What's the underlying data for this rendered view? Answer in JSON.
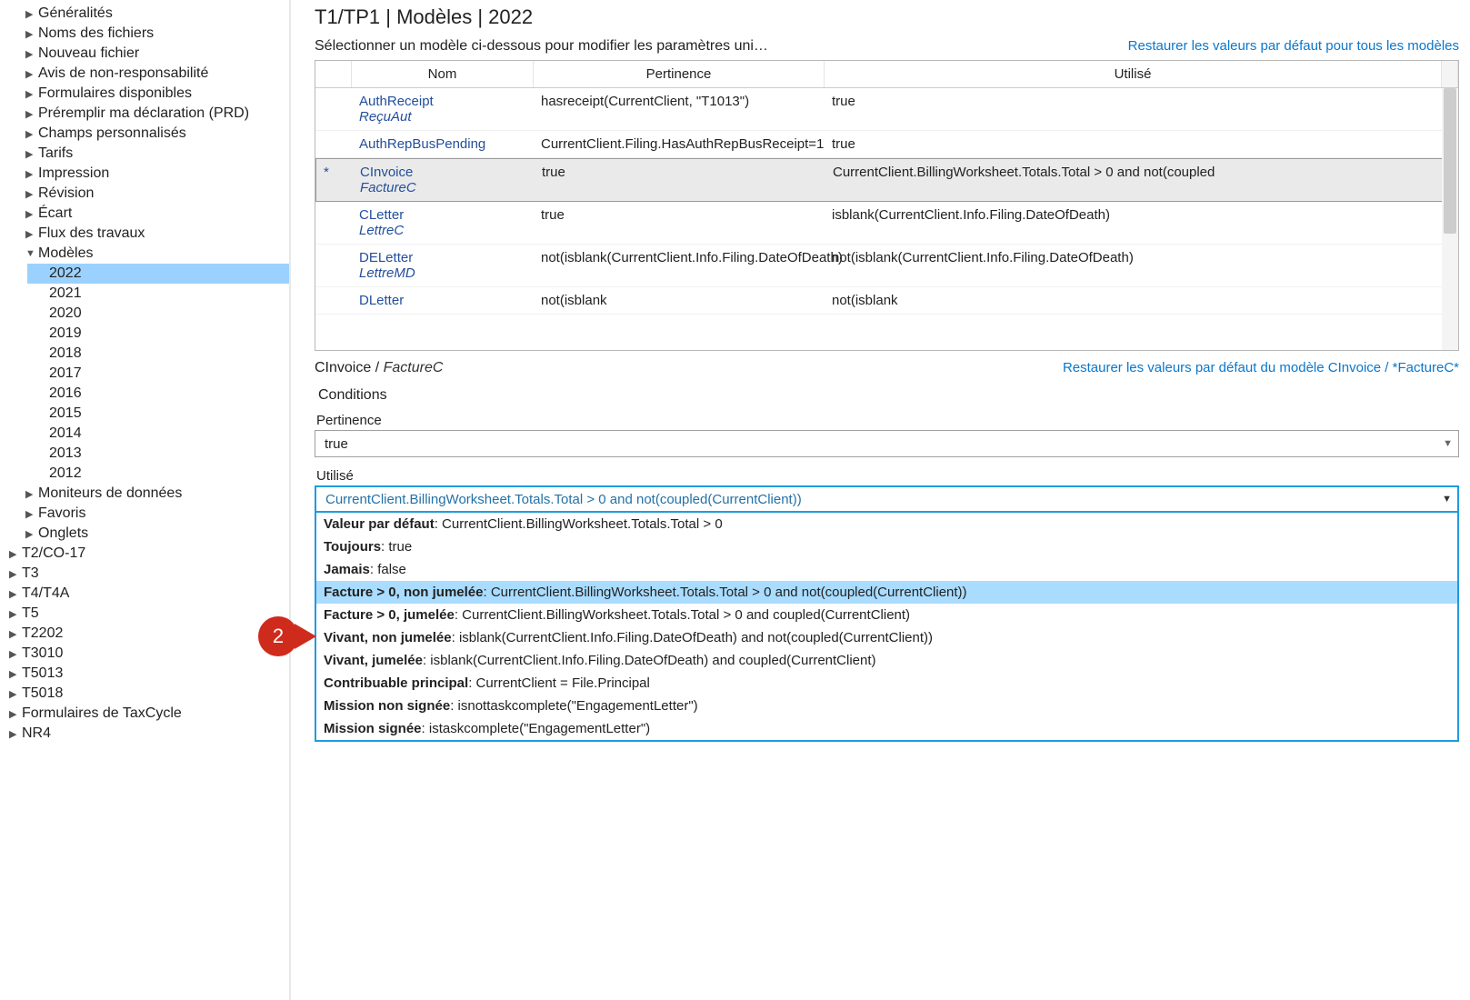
{
  "sidebar": {
    "top": [
      {
        "label": "Généralités",
        "caret": "right"
      },
      {
        "label": "Noms des fichiers",
        "caret": "right"
      },
      {
        "label": "Nouveau fichier",
        "caret": "right"
      },
      {
        "label": "Avis de non-responsabilité",
        "caret": "right"
      },
      {
        "label": "Formulaires disponibles",
        "caret": "right"
      },
      {
        "label": "Préremplir ma déclaration (PRD)",
        "caret": "right"
      },
      {
        "label": "Champs personnalisés",
        "caret": "right"
      },
      {
        "label": "Tarifs",
        "caret": "right"
      },
      {
        "label": "Impression",
        "caret": "right"
      },
      {
        "label": "Révision",
        "caret": "right"
      },
      {
        "label": "Écart",
        "caret": "right"
      },
      {
        "label": "Flux des travaux",
        "caret": "right"
      }
    ],
    "modeles_label": "Modèles",
    "years": [
      "2022",
      "2021",
      "2020",
      "2019",
      "2018",
      "2017",
      "2016",
      "2015",
      "2014",
      "2013",
      "2012"
    ],
    "bottom": [
      {
        "label": "Moniteurs de données",
        "caret": "right"
      },
      {
        "label": "Favoris",
        "caret": "right"
      },
      {
        "label": "Onglets",
        "caret": "right"
      }
    ],
    "root_bottom": [
      {
        "label": "T2/CO-17",
        "caret": "right"
      },
      {
        "label": "T3",
        "caret": "right"
      },
      {
        "label": "T4/T4A",
        "caret": "right"
      },
      {
        "label": "T5",
        "caret": "right"
      },
      {
        "label": "T2202",
        "caret": "right"
      },
      {
        "label": "T3010",
        "caret": "right"
      },
      {
        "label": "T5013",
        "caret": "right"
      },
      {
        "label": "T5018",
        "caret": "right"
      },
      {
        "label": "Formulaires de TaxCycle",
        "caret": "right"
      },
      {
        "label": "NR4",
        "caret": "right"
      }
    ]
  },
  "page": {
    "title": "T1/TP1 | Modèles | 2022",
    "subtitle": "Sélectionner un modèle ci-dessous pour modifier les paramètres uni…",
    "restore_all": "Restaurer les valeurs par défaut pour tous les modèles"
  },
  "grid": {
    "cols": {
      "name": "Nom",
      "rel": "Pertinence",
      "used": "Utilisé"
    },
    "rows": [
      {
        "name": "AuthReceipt",
        "alias": "ReçuAut",
        "rel": "hasreceipt(CurrentClient, \"T1013\")",
        "used": "true",
        "mark": ""
      },
      {
        "name": "AuthRepBusPending",
        "alias": "",
        "rel": "CurrentClient.Filing.HasAuthRepBusReceipt=1",
        "used": "true",
        "mark": ""
      },
      {
        "name": "CInvoice",
        "alias": "FactureC",
        "rel": "true",
        "used": "CurrentClient.BillingWorksheet.Totals.Total > 0 and not(coupled",
        "mark": "*",
        "selected": true
      },
      {
        "name": "CLetter",
        "alias": "LettreC",
        "rel": "true",
        "used": "isblank(CurrentClient.Info.Filing.DateOfDeath)",
        "mark": ""
      },
      {
        "name": "DELetter",
        "alias": "LettreMD",
        "rel": "not(isblank(CurrentClient.Info.Filing.DateOfDeath)",
        "used": "not(isblank(CurrentClient.Info.Filing.DateOfDeath)",
        "mark": ""
      },
      {
        "name": "DLetter",
        "alias": "",
        "rel": "not(isblank",
        "used": "not(isblank",
        "mark": ""
      }
    ]
  },
  "detail": {
    "name": "CInvoice",
    "alias": "FactureC",
    "restore": "Restaurer les valeurs par défaut du modèle CInvoice / *FactureC*",
    "conditions": "Conditions",
    "pertinence_label": "Pertinence",
    "pertinence_value": "true",
    "used_label": "Utilisé",
    "used_value": "CurrentClient.BillingWorksheet.Totals.Total > 0 and not(coupled(CurrentClient))",
    "options": [
      {
        "bold": "Valeur par défaut",
        "rest": ": CurrentClient.BillingWorksheet.Totals.Total > 0"
      },
      {
        "bold": "Toujours",
        "rest": ": true"
      },
      {
        "bold": "Jamais",
        "rest": ": false"
      },
      {
        "bold": "Facture > 0, non jumelée",
        "rest": ": CurrentClient.BillingWorksheet.Totals.Total > 0 and not(coupled(CurrentClient))",
        "sel": true
      },
      {
        "bold": "Facture > 0, jumelée",
        "rest": ": CurrentClient.BillingWorksheet.Totals.Total > 0 and coupled(CurrentClient)"
      },
      {
        "bold": "Vivant, non jumelée",
        "rest": ": isblank(CurrentClient.Info.Filing.DateOfDeath) and not(coupled(CurrentClient))"
      },
      {
        "bold": "Vivant, jumelée",
        "rest": ": isblank(CurrentClient.Info.Filing.DateOfDeath) and coupled(CurrentClient)"
      },
      {
        "bold": "Contribuable principal",
        "rest": ": CurrentClient = File.Principal"
      },
      {
        "bold": "Mission non signée",
        "rest": ": isnottaskcomplete(\"EngagementLetter\")"
      },
      {
        "bold": "Mission signée",
        "rest": ": istaskcomplete(\"EngagementLetter\")"
      }
    ]
  },
  "callout": "2"
}
